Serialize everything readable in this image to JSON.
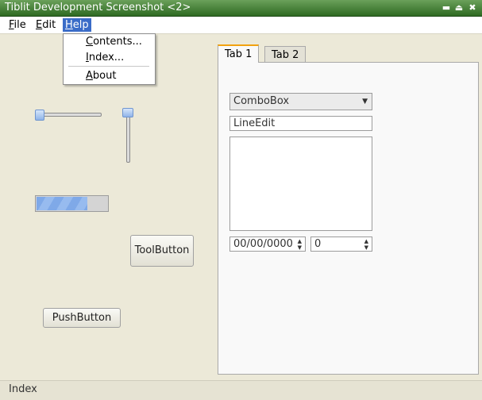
{
  "window": {
    "title": "Tiblit Development Screenshot <2>"
  },
  "titlebar_buttons": [
    "▬",
    "⏏",
    "✖"
  ],
  "menubar": {
    "items": [
      {
        "label": "File",
        "ul": "F",
        "rest": "ile"
      },
      {
        "label": "Edit",
        "ul": "E",
        "rest": "dit"
      },
      {
        "label": "Help",
        "ul": "H",
        "rest": "elp"
      }
    ]
  },
  "help_menu": {
    "items": [
      {
        "label": "Contents...",
        "ul": "C",
        "rest": "ontents..."
      },
      {
        "label": "Index...",
        "ul": "I",
        "rest": "ndex..."
      },
      {
        "label": "About",
        "ul": "A",
        "rest": "bout"
      }
    ]
  },
  "controls": {
    "progress_value": 0.72,
    "toolbutton_label": "ToolButton",
    "pushbutton_label": "PushButton"
  },
  "tabs": [
    {
      "label": "Tab 1",
      "active": true
    },
    {
      "label": "Tab 2",
      "active": false
    }
  ],
  "tab1": {
    "combobox_value": "ComboBox",
    "lineedit_value": "LineEdit",
    "dateedit_value": "00/00/0000",
    "spinbox_value": "0"
  },
  "statusbar": {
    "text": "Index"
  }
}
